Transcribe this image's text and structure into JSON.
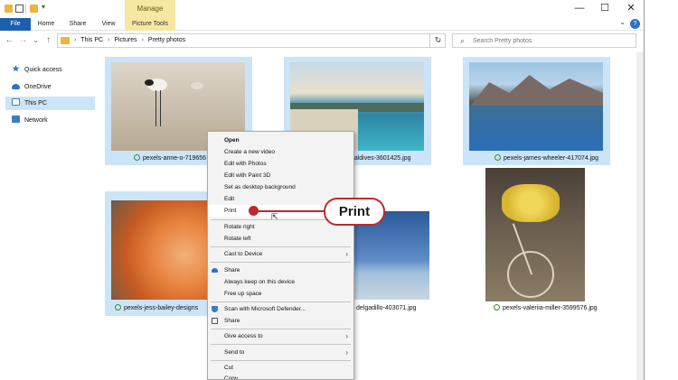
{
  "titlebar": {
    "manage_tab": "Manage",
    "minimize": "—",
    "maximize": "☐",
    "close": "✕"
  },
  "ribbon": {
    "tabs": [
      "File",
      "Home",
      "Share",
      "View",
      "Picture Tools"
    ],
    "collapse": "⌄",
    "help": "?"
  },
  "address": {
    "back": "←",
    "forward": "→",
    "recent": "⌄",
    "up": "↑",
    "crumbs": [
      "This PC",
      "Pictures",
      "Pretty photos"
    ],
    "separator": "›",
    "dropdown": "⌄",
    "refresh": "↻"
  },
  "search": {
    "icon": "⌕",
    "placeholder": "Search Pretty photos"
  },
  "sidebar": {
    "items": [
      {
        "label": "Quick access",
        "icon": "star-icon",
        "color": "#2d73c7"
      },
      {
        "label": "OneDrive",
        "icon": "cloud-icon",
        "color": "#2d73c7"
      },
      {
        "label": "This PC",
        "icon": "computer-icon",
        "color": "#3b7dc4"
      },
      {
        "label": "Network",
        "icon": "network-icon",
        "color": "#3b7dc4"
      }
    ]
  },
  "files": [
    {
      "name": "pexels-anne-o-719656",
      "selected": true
    },
    {
      "name": "maldives-3601425.jpg",
      "selected": true
    },
    {
      "name": "pexels-james-wheeler-417074.jpg",
      "selected": true
    },
    {
      "name": "pexels-jess-bailey-designs",
      "selected": true
    },
    {
      "name": "delgadillo-403071.jpg",
      "selected": false
    },
    {
      "name": "pexels-valeriia-miller-3599576.jpg",
      "selected": false
    }
  ],
  "context_menu": {
    "items": [
      {
        "label": "Open",
        "bold": true
      },
      {
        "label": "Create a new video"
      },
      {
        "label": "Edit with Photos"
      },
      {
        "label": "Edit with Paint 3D"
      },
      {
        "label": "Set as desktop background"
      },
      {
        "label": "Edit"
      },
      {
        "label": "Print",
        "highlight": true
      },
      {
        "separator": true
      },
      {
        "label": "Rotate right"
      },
      {
        "label": "Rotate left"
      },
      {
        "separator": true
      },
      {
        "label": "Cast to Device",
        "submenu": true
      },
      {
        "separator": true
      },
      {
        "label": "Share",
        "icon": "cloud-icon"
      },
      {
        "label": "Always keep on this device"
      },
      {
        "label": "Free up space"
      },
      {
        "separator": true
      },
      {
        "label": "Scan with Microsoft Defender...",
        "icon": "shield-icon"
      },
      {
        "label": "Share",
        "icon": "share-icon"
      },
      {
        "separator": true
      },
      {
        "label": "Give access to",
        "submenu": true
      },
      {
        "separator": true
      },
      {
        "label": "Send to",
        "submenu": true
      },
      {
        "separator": true
      },
      {
        "label": "Cut"
      },
      {
        "label": "Copy"
      }
    ],
    "submenu_arrow": "›"
  },
  "callout": {
    "label": "Print"
  },
  "colors": {
    "accent": "#1d5fad",
    "selection": "#cce4f7",
    "picture_tools": "#f6e7a3",
    "callout": "#c0282e"
  }
}
